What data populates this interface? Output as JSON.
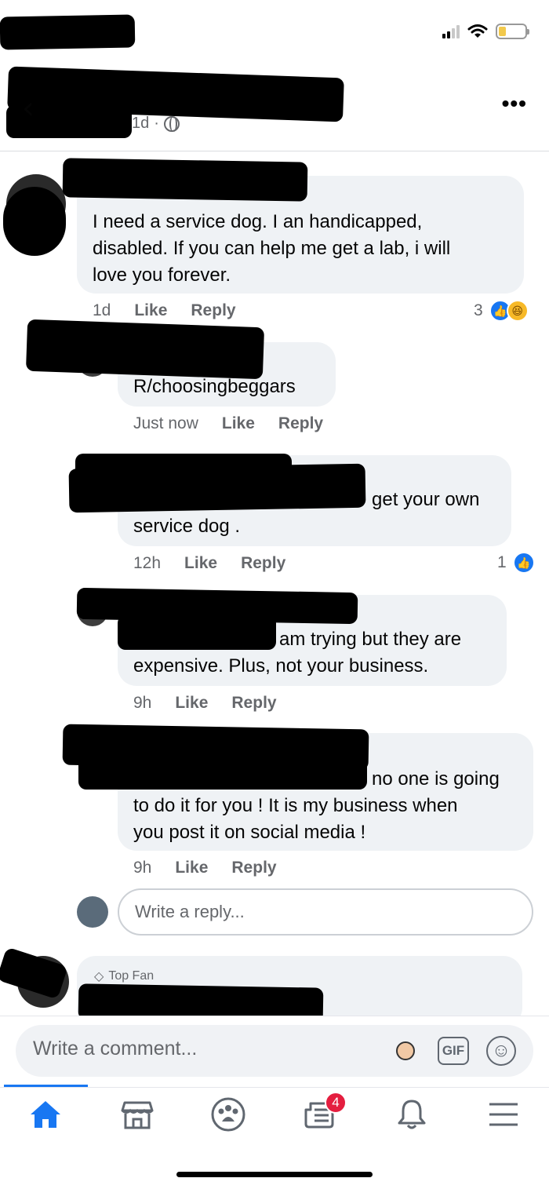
{
  "header": {
    "post_age": "1d",
    "visibility_icon": "globe-icon"
  },
  "comments": [
    {
      "text": "I need a service dog.  I an handicapped, disabled.  If you can help me get a lab, i will love you forever.",
      "lines": [
        "I need a service dog.  I an handicapped,",
        "disabled.  If you can help me get a lab, i will",
        "love you forever."
      ],
      "time": "1d",
      "like": "Like",
      "reply": "Reply",
      "reaction_count": "3",
      "reactions": [
        "like",
        "haha"
      ]
    },
    {
      "text": "R/choosingbeggars",
      "time": "Just now",
      "like": "Like",
      "reply": "Reply"
    },
    {
      "lines": [
        "get your own",
        "service dog ."
      ],
      "time": "12h",
      "like": "Like",
      "reply": "Reply",
      "reaction_count": "1",
      "reactions": [
        "like"
      ]
    },
    {
      "lines": [
        "am trying but they are",
        "expensive.  Plus, not your business."
      ],
      "time": "9h",
      "like": "Like",
      "reply": "Reply"
    },
    {
      "lines": [
        "no one is going",
        "to do it for you ! It is my business when",
        "you post it on social media !"
      ],
      "time": "9h",
      "like": "Like",
      "reply": "Reply"
    }
  ],
  "reply_box": {
    "placeholder": "Write a reply..."
  },
  "next_comment": {
    "badge": "Top Fan"
  },
  "composer": {
    "placeholder": "Write a comment...",
    "gif_label": "GIF"
  },
  "tabbar": {
    "active": "home",
    "items": [
      "home",
      "marketplace",
      "groups",
      "news",
      "notifications",
      "menu"
    ],
    "news_badge": "4"
  },
  "colors": {
    "accent": "#1877f2",
    "bubble": "#eff2f5",
    "badge": "#e41e3f"
  }
}
